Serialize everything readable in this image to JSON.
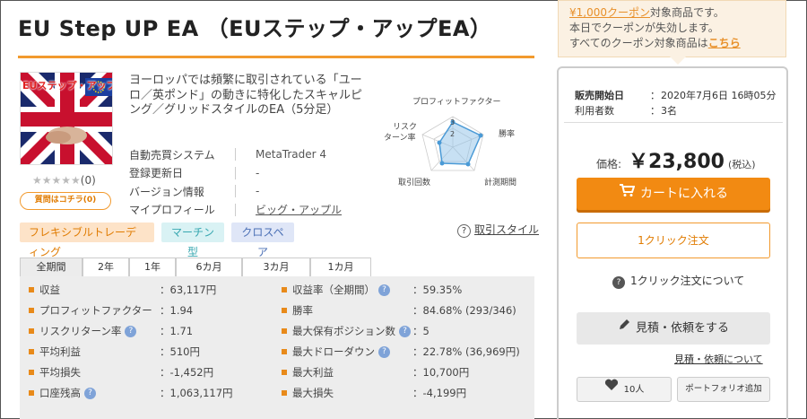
{
  "page": {
    "title": "EU Step UP EA （EUステップ・アップEA）"
  },
  "coupon": {
    "amount": "¥1,000クーポン",
    "line1_suffix": "対象商品です。",
    "line2": "本日でクーポンが失効します。",
    "line3_prefix": "すべてのクーポン対象商品は",
    "line3_link": "こちら"
  },
  "product": {
    "image_text": "EUステップ・アップEA",
    "rating_stars": "★★★★★",
    "rating_count": "(0)",
    "question_button": "質問はコチラ(0)",
    "description": "ヨーロッパでは頻繁に取引されている「ユーロ／英ポンド」の動きに特化したスキャルピング／グリッドスタイルのEA（5分足）",
    "meta": [
      {
        "key": "自動売買システム",
        "value": "MetaTrader 4"
      },
      {
        "key": "登録更新日",
        "value": "-"
      },
      {
        "key": "バージョン情報",
        "value": "-"
      },
      {
        "key": "マイプロフィール",
        "value": "ビッグ・アップル"
      }
    ]
  },
  "radar": {
    "labels": [
      "プロフィットファクター",
      "勝率",
      "計測期間",
      "取引回数",
      "リスク",
      "ターン率"
    ],
    "ticks": [
      "3",
      "2"
    ]
  },
  "tags": [
    "フレキシブルトレーディング",
    "マーチン型",
    "クロスペア"
  ],
  "guide_link": "取引スタイル",
  "tabs": [
    "全期間",
    "2年",
    "1年",
    "6カ月",
    "3カ月",
    "1カ月"
  ],
  "stats_left": [
    {
      "label": "収益",
      "value": "63,117円",
      "help": false
    },
    {
      "label": "プロフィットファクター",
      "value": "1.94",
      "help": false
    },
    {
      "label": "リスクリターン率",
      "value": "1.71",
      "help": true
    },
    {
      "label": "平均利益",
      "value": "510円",
      "help": false
    },
    {
      "label": "平均損失",
      "value": "-1,452円",
      "help": false
    },
    {
      "label": "口座残高",
      "value": "1,063,117円",
      "help": true
    }
  ],
  "stats_right": [
    {
      "label": "収益率（全期間）",
      "value": "59.35%",
      "help": true
    },
    {
      "label": "勝率",
      "value": "84.68% (293/346)",
      "help": false
    },
    {
      "label": "最大保有ポジション数",
      "value": "5",
      "help": true
    },
    {
      "label": "最大ドローダウン",
      "value": "22.78% (36,969円)",
      "help": true
    },
    {
      "label": "最大利益",
      "value": "10,700円",
      "help": false
    },
    {
      "label": "最大損失",
      "value": "-4,199円",
      "help": false
    }
  ],
  "purchase": {
    "sale_start_label": "販売開始日",
    "sale_start_value": "2020年7月6日 16時05分",
    "users_label": "利用者数",
    "users_value": "3名",
    "price_label": "価格:",
    "price_value": "￥23,800",
    "tax_note": "(税込)",
    "cart_button": "カートに入れる",
    "oneclick_button": "1クリック注文",
    "oneclick_about": "1クリック注文について",
    "estimate_button": "見積・依頼をする",
    "estimate_link": "見積・依頼について",
    "favorite_count": "10人",
    "portfolio_button": "ポートフォリオ追加"
  },
  "colors": {
    "accent": "#f28a12",
    "panel_border": "#cccccc",
    "stats_bg": "#ededed"
  }
}
